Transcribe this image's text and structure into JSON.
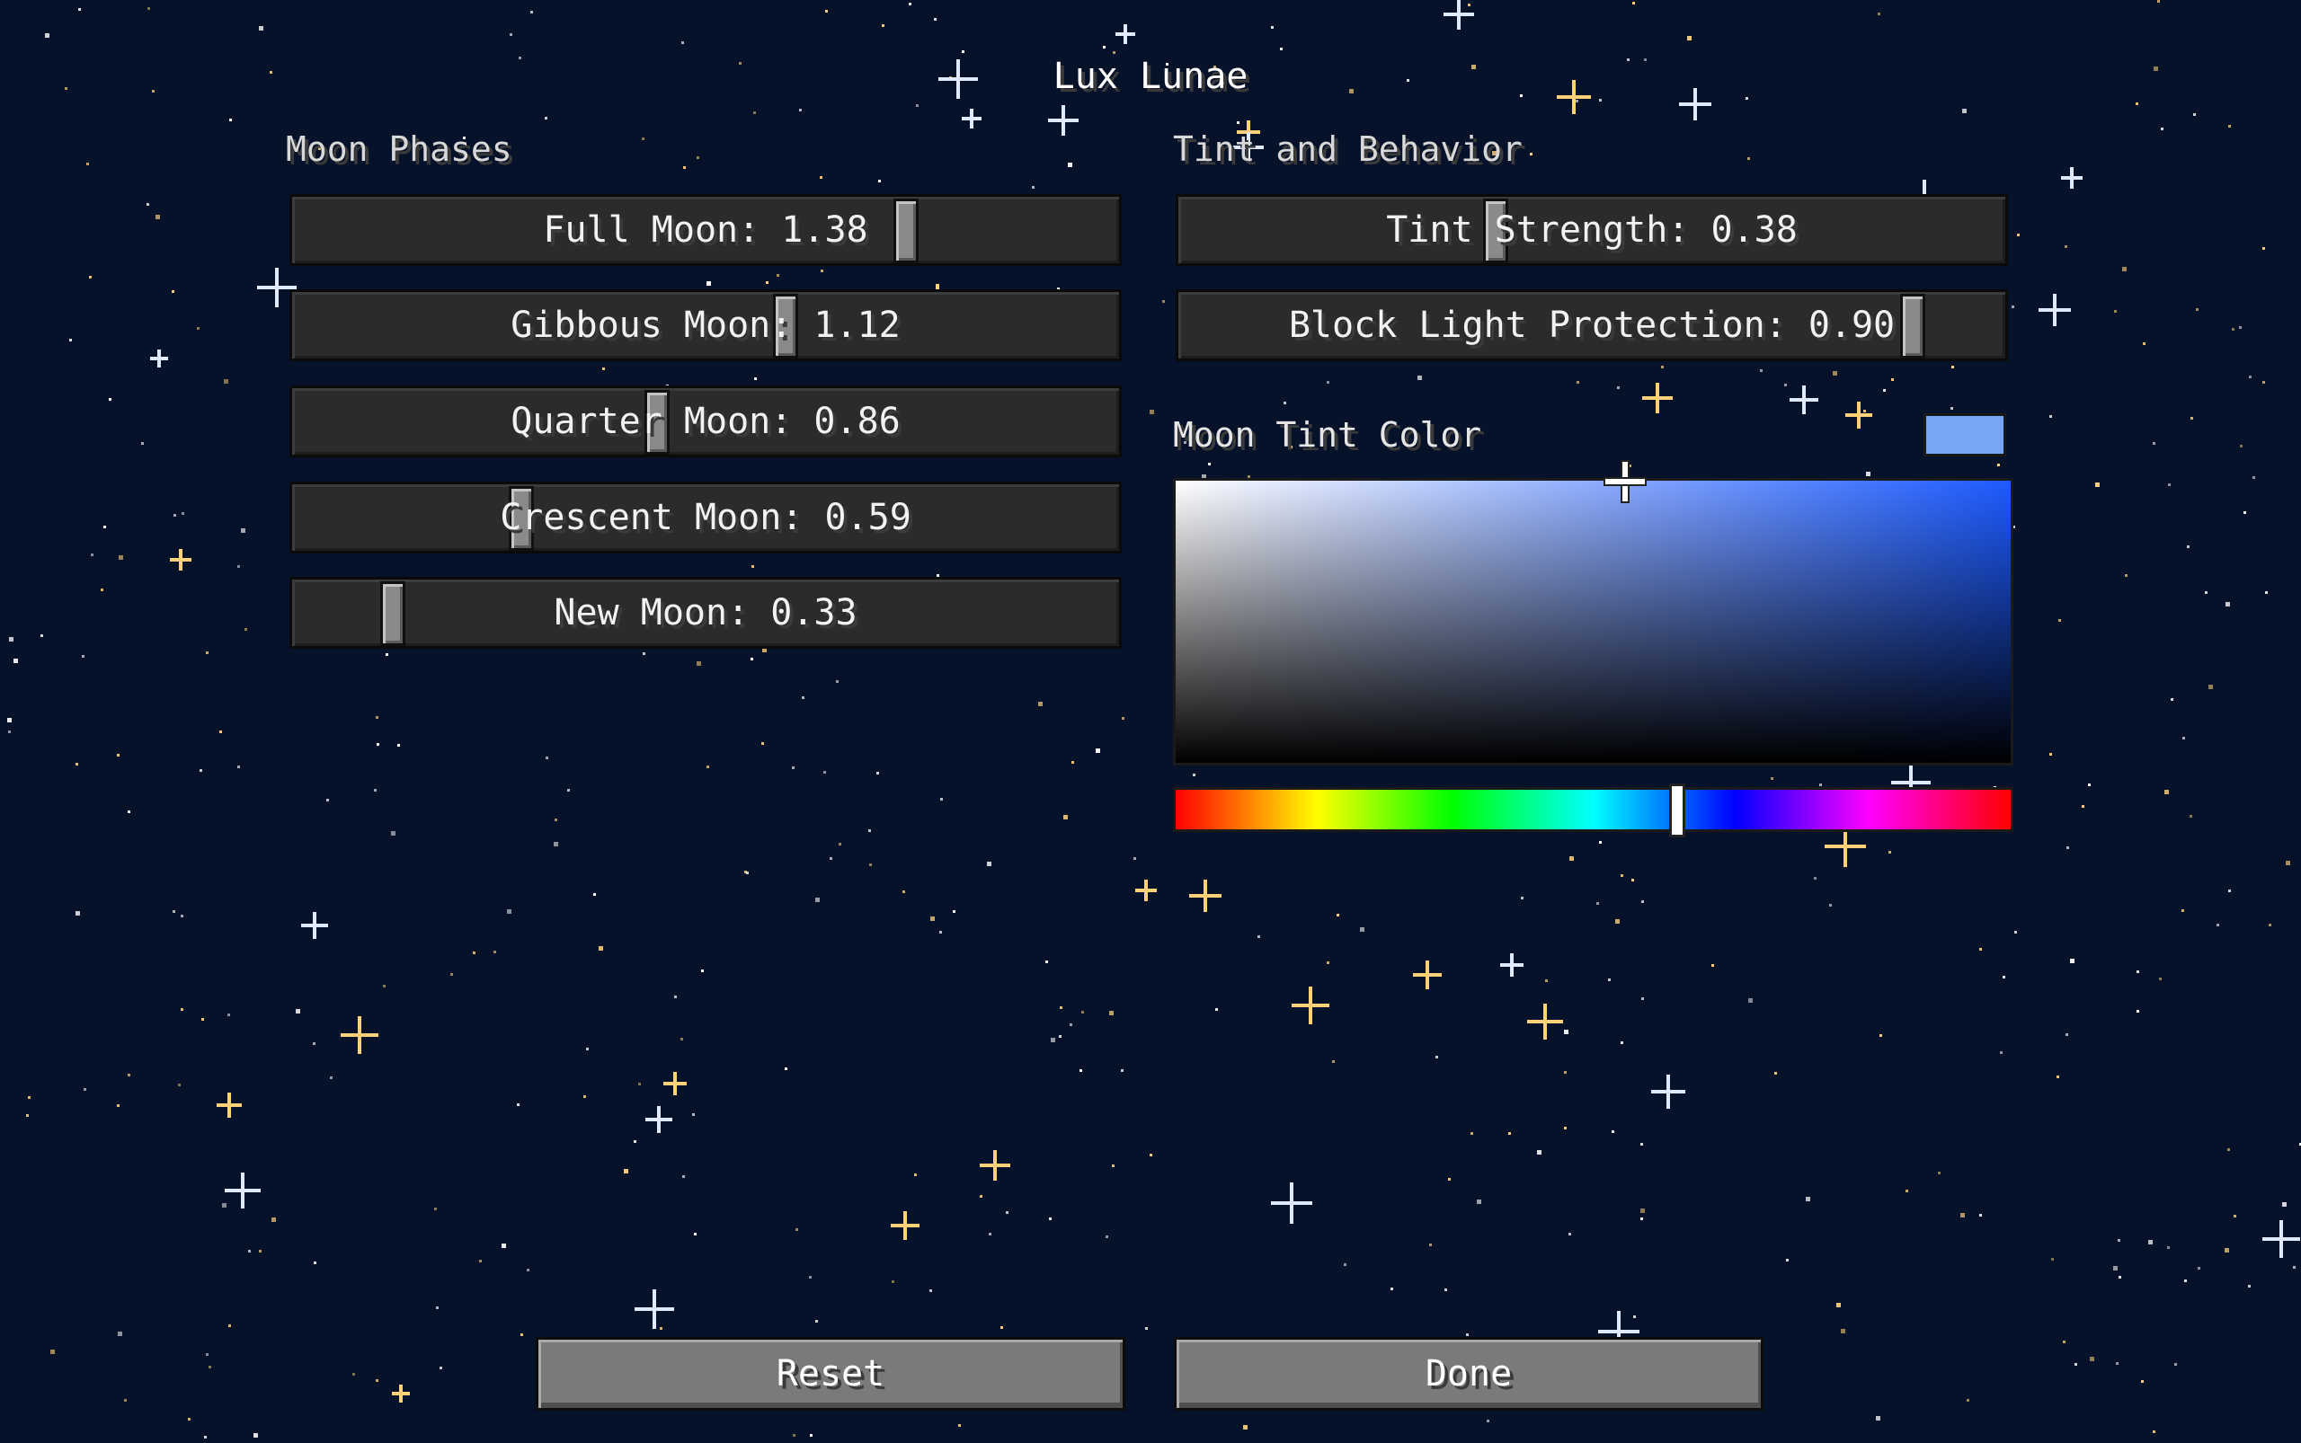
{
  "screen": {
    "title": "Lux Lunae"
  },
  "moon_phases": {
    "heading": "Moon Phases",
    "sliders": [
      {
        "label": "Full Moon: 1.38",
        "fraction": 0.75
      },
      {
        "label": "Gibbous Moon: 1.12",
        "fraction": 0.6
      },
      {
        "label": "Quarter Moon: 0.86",
        "fraction": 0.44
      },
      {
        "label": "Crescent Moon: 0.59",
        "fraction": 0.27
      },
      {
        "label": "New Moon: 0.33",
        "fraction": 0.11
      }
    ]
  },
  "tint_behavior": {
    "heading": "Tint and Behavior",
    "sliders": [
      {
        "label": "Tint Strength: 0.38",
        "fraction": 0.38
      },
      {
        "label": "Block Light Protection: 0.90",
        "fraction": 0.9
      }
    ]
  },
  "color_picker": {
    "label": "Moon Tint Color",
    "swatch_color": "#78a6f5",
    "hue_color": "#1d5bff",
    "hue_fraction": 0.6,
    "saturation_fraction": 0.53,
    "brightness_fraction": 1.0
  },
  "buttons": {
    "reset": "Reset",
    "done": "Done"
  },
  "colors": {
    "background": "#06112a",
    "star_white": "#ffffff",
    "star_gold": "#ffd27a"
  }
}
